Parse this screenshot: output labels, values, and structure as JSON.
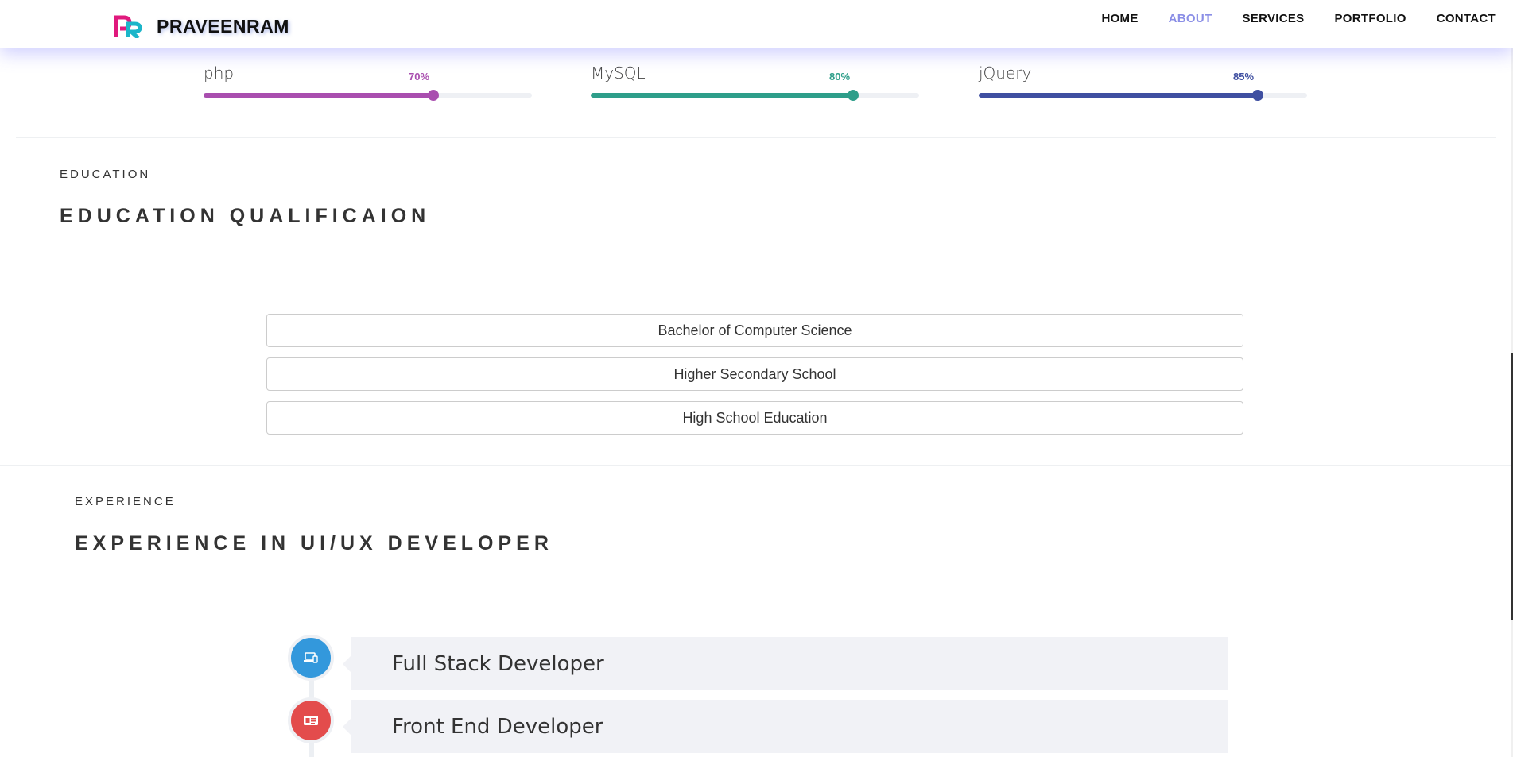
{
  "header": {
    "brand": "PRAVEENRAM",
    "nav": [
      {
        "label": "HOME"
      },
      {
        "label": "ABOUT",
        "active": true
      },
      {
        "label": "SERVICES"
      },
      {
        "label": "PORTFOLIO"
      },
      {
        "label": "CONTACT"
      }
    ]
  },
  "skills": [
    {
      "name": "php",
      "percent_label": "70%",
      "level": 0.7,
      "color": "#a94eaf"
    },
    {
      "name": "MySQL",
      "percent_label": "80%",
      "level": 0.8,
      "color": "#2e9e8a"
    },
    {
      "name": "jQuery",
      "percent_label": "85%",
      "level": 0.85,
      "color": "#3f4fa1"
    }
  ],
  "education": {
    "sub_heading": "EDUCATION",
    "heading": "EDUCATION QUALIFICAION",
    "items": [
      "Bachelor of Computer Science",
      "Higher Secondary School",
      "High School Education"
    ]
  },
  "experience": {
    "sub_heading": "EXPERIENCE",
    "heading": "EXPERIENCE IN UI/UX DEVELOPER",
    "items": [
      {
        "title": "Full Stack Developer",
        "icon": "laptop-icon",
        "color": "#3398dc"
      },
      {
        "title": "Front End Developer",
        "icon": "id-card-icon",
        "color": "#e34c4c"
      }
    ]
  }
}
